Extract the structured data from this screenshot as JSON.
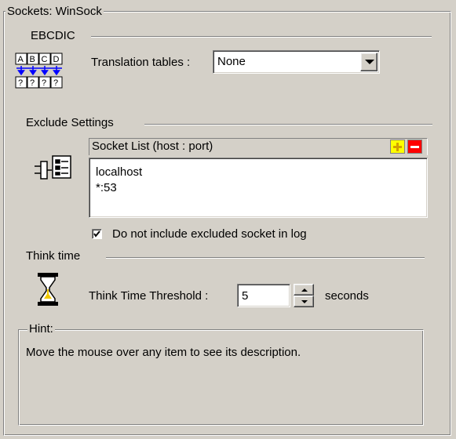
{
  "group_title": "Sockets: WinSock",
  "ebcdic": {
    "section_label": "EBCDIC",
    "icon_top": "ABCD",
    "icon_bottom": "????",
    "translation_label": "Translation tables :",
    "translation_value": "None"
  },
  "exclude": {
    "section_label": "Exclude Settings",
    "socket_list_header": "Socket List (host : port)",
    "add_symbol": "+",
    "remove_symbol": "−",
    "sockets": [
      "localhost",
      "*:53"
    ],
    "checkbox_label": "Do not include excluded socket in log",
    "checkbox_checked": true
  },
  "think_time": {
    "section_label": "Think time",
    "threshold_label": "Think Time Threshold :",
    "threshold_value": "5",
    "unit": "seconds"
  },
  "hint": {
    "title": "Hint:",
    "text": "Move the mouse over any item to see its description."
  },
  "colors": {
    "add_button_bg": "#ffff00",
    "remove_button_bg": "#ff0000",
    "hourglass_sand": "#f0c800"
  }
}
